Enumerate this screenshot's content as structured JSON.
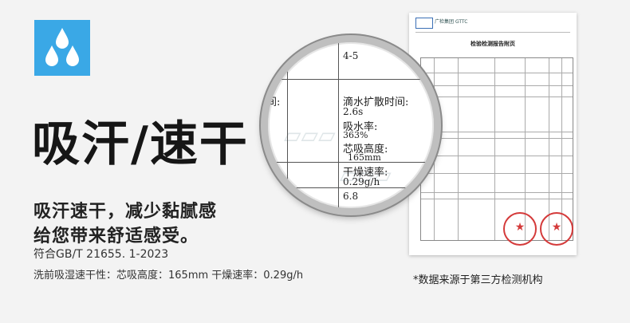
{
  "headline": "吸汗/速干",
  "subtitle_line1": "吸汗速干，减少黏腻感",
  "subtitle_line2": "给您带来舒适感受。",
  "standard": "符合GB/T 21655. 1-2023",
  "detail": "洗前吸湿速干性：芯吸高度：165mm    干燥速率：0.29g/h",
  "source_note": "*数据来源于第三方检测机构",
  "icon": {
    "name": "water-drops-icon",
    "bg": "#3aa8e6",
    "fg": "#ffffff"
  },
  "report": {
    "org": "广检集团",
    "org_en": "GTTC",
    "title": "检验检测报告附页"
  },
  "magnifier": {
    "top_value": "4-5",
    "side_label": "间:",
    "row1_label": "滴水扩散时间:",
    "row1_value": "2.6s",
    "row2_label": "吸水率:",
    "row2_value": "363%",
    "row3_label": "芯吸高度:",
    "row3_value": "165mm",
    "row4_label": "干燥速率:",
    "row4_value": "0.29g/h",
    "bottom_value": "6.8"
  }
}
